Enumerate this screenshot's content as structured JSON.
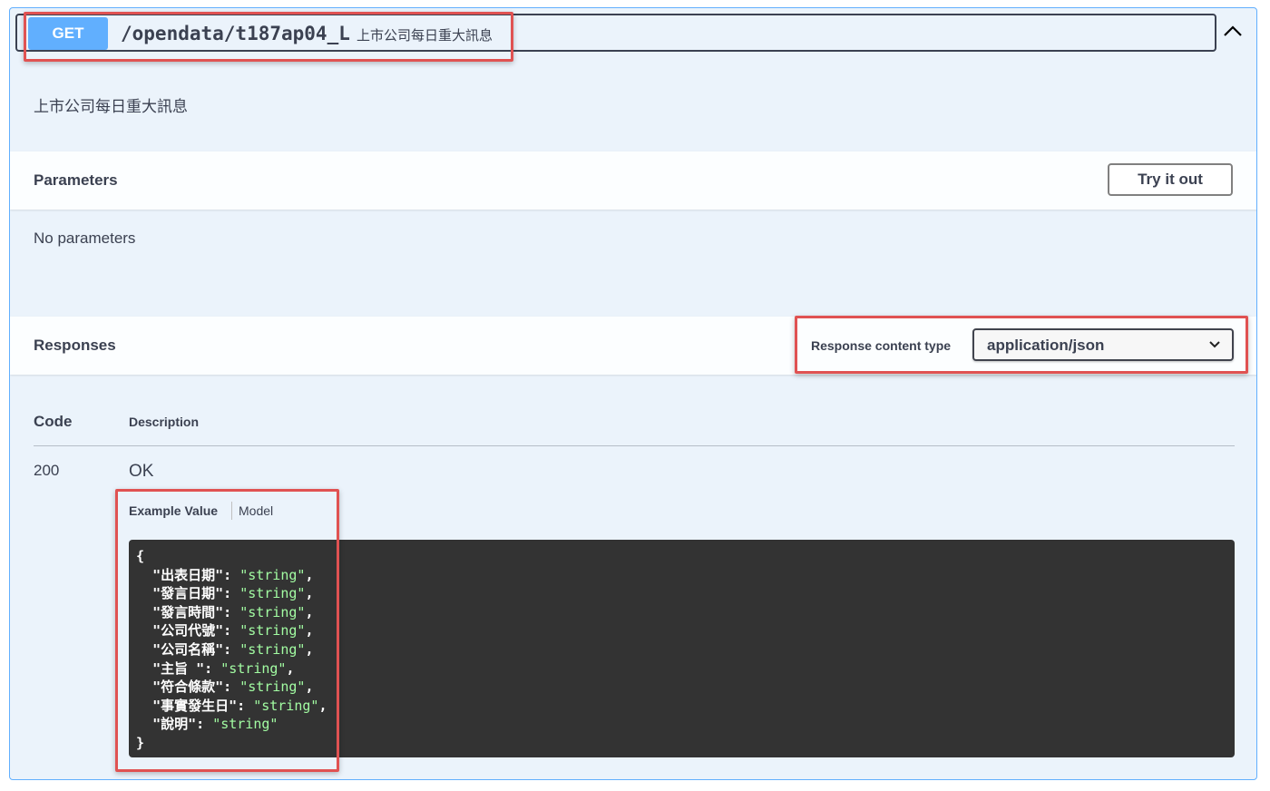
{
  "endpoint": {
    "method": "GET",
    "path": "/opendata/t187ap04_L",
    "summary": "上市公司每日重大訊息",
    "description": "上市公司每日重大訊息"
  },
  "parameters": {
    "title": "Parameters",
    "try_label": "Try it out",
    "empty_text": "No parameters"
  },
  "responses": {
    "title": "Responses",
    "content_type_label": "Response content type",
    "content_type_value": "application/json",
    "table_headers": {
      "code": "Code",
      "description": "Description"
    },
    "rows": [
      {
        "code": "200",
        "description": "OK"
      }
    ],
    "tabs": {
      "example": "Example Value",
      "model": "Model"
    },
    "example_open": "{",
    "example_close": "}",
    "example_fields": [
      {
        "key": "\"出表日期\"",
        "value": "\"string\"",
        "sep": ": ",
        "trail": ","
      },
      {
        "key": "\"發言日期\"",
        "value": "\"string\"",
        "sep": ": ",
        "trail": ","
      },
      {
        "key": "\"發言時間\"",
        "value": "\"string\"",
        "sep": ": ",
        "trail": ","
      },
      {
        "key": "\"公司代號\"",
        "value": "\"string\"",
        "sep": ": ",
        "trail": ","
      },
      {
        "key": "\"公司名稱\"",
        "value": "\"string\"",
        "sep": ": ",
        "trail": ","
      },
      {
        "key": "\"主旨 \"",
        "value": "\"string\"",
        "sep": ": ",
        "trail": ","
      },
      {
        "key": "\"符合條款\"",
        "value": "\"string\"",
        "sep": ": ",
        "trail": ","
      },
      {
        "key": "\"事實發生日\"",
        "value": "\"string\"",
        "sep": ": ",
        "trail": ","
      },
      {
        "key": "\"說明\"",
        "value": "\"string\"",
        "sep": ": ",
        "trail": ""
      }
    ]
  },
  "colors": {
    "get_method": "#61affe",
    "block_bg": "#ebf3fb",
    "highlight": "#e05252",
    "code_bg": "#333333",
    "code_string": "#a2fca2"
  },
  "icons": {
    "collapse": "chevron-up-icon",
    "select": "chevron-down-icon"
  }
}
